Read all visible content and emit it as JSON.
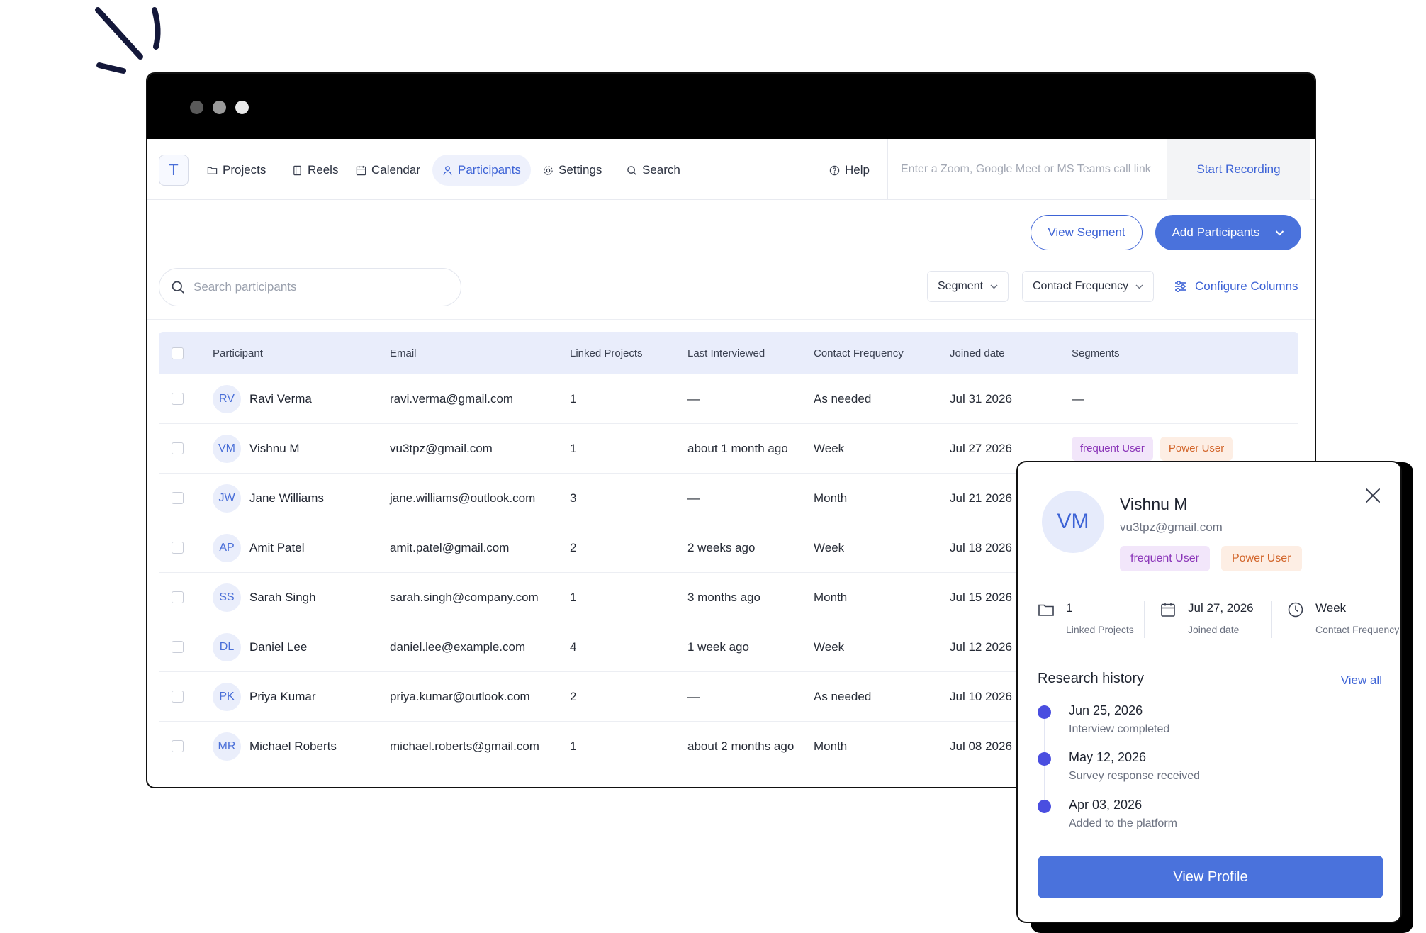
{
  "colors": {
    "accent": "#4a72dc",
    "accent_text": "#3d63d6",
    "header_bg": "#e9edfb",
    "tag_frequent_bg": "#f2e6fa",
    "tag_frequent_text": "#8a34b8",
    "tag_power_bg": "#fdeee4",
    "tag_power_text": "#d2652a",
    "timeline_dot": "#4a4ee0"
  },
  "nav": {
    "logo": "T",
    "items": [
      {
        "label": "Projects",
        "icon": "folder-icon"
      },
      {
        "label": "Reels",
        "icon": "film-icon"
      },
      {
        "label": "Calendar",
        "icon": "calendar-icon"
      },
      {
        "label": "Participants",
        "icon": "users-icon",
        "active": true
      },
      {
        "label": "Settings",
        "icon": "gear-icon"
      },
      {
        "label": "Search",
        "icon": "search-icon"
      }
    ],
    "help": "Help",
    "call_link_placeholder": "Enter a Zoom, Google Meet or MS Teams call link",
    "start_recording": "Start Recording"
  },
  "actions": {
    "view_segment": "View Segment",
    "add_participants": "Add Participants"
  },
  "toolbar": {
    "search_placeholder": "Search participants",
    "segment_filter": "Segment",
    "contact_frequency_filter": "Contact Frequency",
    "configure_columns": "Configure Columns"
  },
  "table": {
    "columns": [
      "Participant",
      "Email",
      "Linked Projects",
      "Last Interviewed",
      "Contact Frequency",
      "Joined date",
      "Segments"
    ],
    "rows": [
      {
        "initials": "RV",
        "name": "Ravi Verma",
        "email": "ravi.verma@gmail.com",
        "linked": "1",
        "last": "—",
        "freq": "As needed",
        "joined": "Jul 31 2026",
        "segments_text": "—"
      },
      {
        "initials": "VM",
        "name": "Vishnu M",
        "email": "vu3tpz@gmail.com",
        "linked": "1",
        "last": "about 1 month ago",
        "freq": "Week",
        "joined": "Jul 27 2026",
        "segments": [
          "frequent User",
          "Power User"
        ]
      },
      {
        "initials": "JW",
        "name": "Jane Williams",
        "email": "jane.williams@outlook.com",
        "linked": "3",
        "last": "—",
        "freq": "Month",
        "joined": "Jul 21 2026"
      },
      {
        "initials": "AP",
        "name": "Amit Patel",
        "email": "amit.patel@gmail.com",
        "linked": "2",
        "last": "2 weeks ago",
        "freq": "Week",
        "joined": "Jul 18 2026"
      },
      {
        "initials": "SS",
        "name": "Sarah Singh",
        "email": "sarah.singh@company.com",
        "linked": "1",
        "last": "3 months ago",
        "freq": "Month",
        "joined": "Jul 15 2026"
      },
      {
        "initials": "DL",
        "name": "Daniel Lee",
        "email": "daniel.lee@example.com",
        "linked": "4",
        "last": "1 week ago",
        "freq": "Week",
        "joined": "Jul 12 2026"
      },
      {
        "initials": "PK",
        "name": "Priya Kumar",
        "email": "priya.kumar@outlook.com",
        "linked": "2",
        "last": "—",
        "freq": "As needed",
        "joined": "Jul 10 2026"
      },
      {
        "initials": "MR",
        "name": "Michael Roberts",
        "email": "michael.roberts@gmail.com",
        "linked": "1",
        "last": "about 2 months ago",
        "freq": "Month",
        "joined": "Jul 08 2026"
      }
    ]
  },
  "card": {
    "initials": "VM",
    "name": "Vishnu M",
    "email": "vu3tpz@gmail.com",
    "tags": [
      "frequent User",
      "Power User"
    ],
    "stats": [
      {
        "value": "1",
        "label": "Linked Projects",
        "icon": "folder-icon"
      },
      {
        "value": "Jul 27, 2026",
        "label": "Joined date",
        "icon": "calendar-icon"
      },
      {
        "value": "Week",
        "label": "Contact Frequency",
        "icon": "clock-icon"
      }
    ],
    "history_title": "Research history",
    "view_all": "View all",
    "history": [
      {
        "date": "Jun 25, 2026",
        "desc": "Interview completed"
      },
      {
        "date": "May 12, 2026",
        "desc": "Survey response received"
      },
      {
        "date": "Apr 03, 2026",
        "desc": "Added to the platform"
      }
    ],
    "view_profile": "View Profile"
  }
}
